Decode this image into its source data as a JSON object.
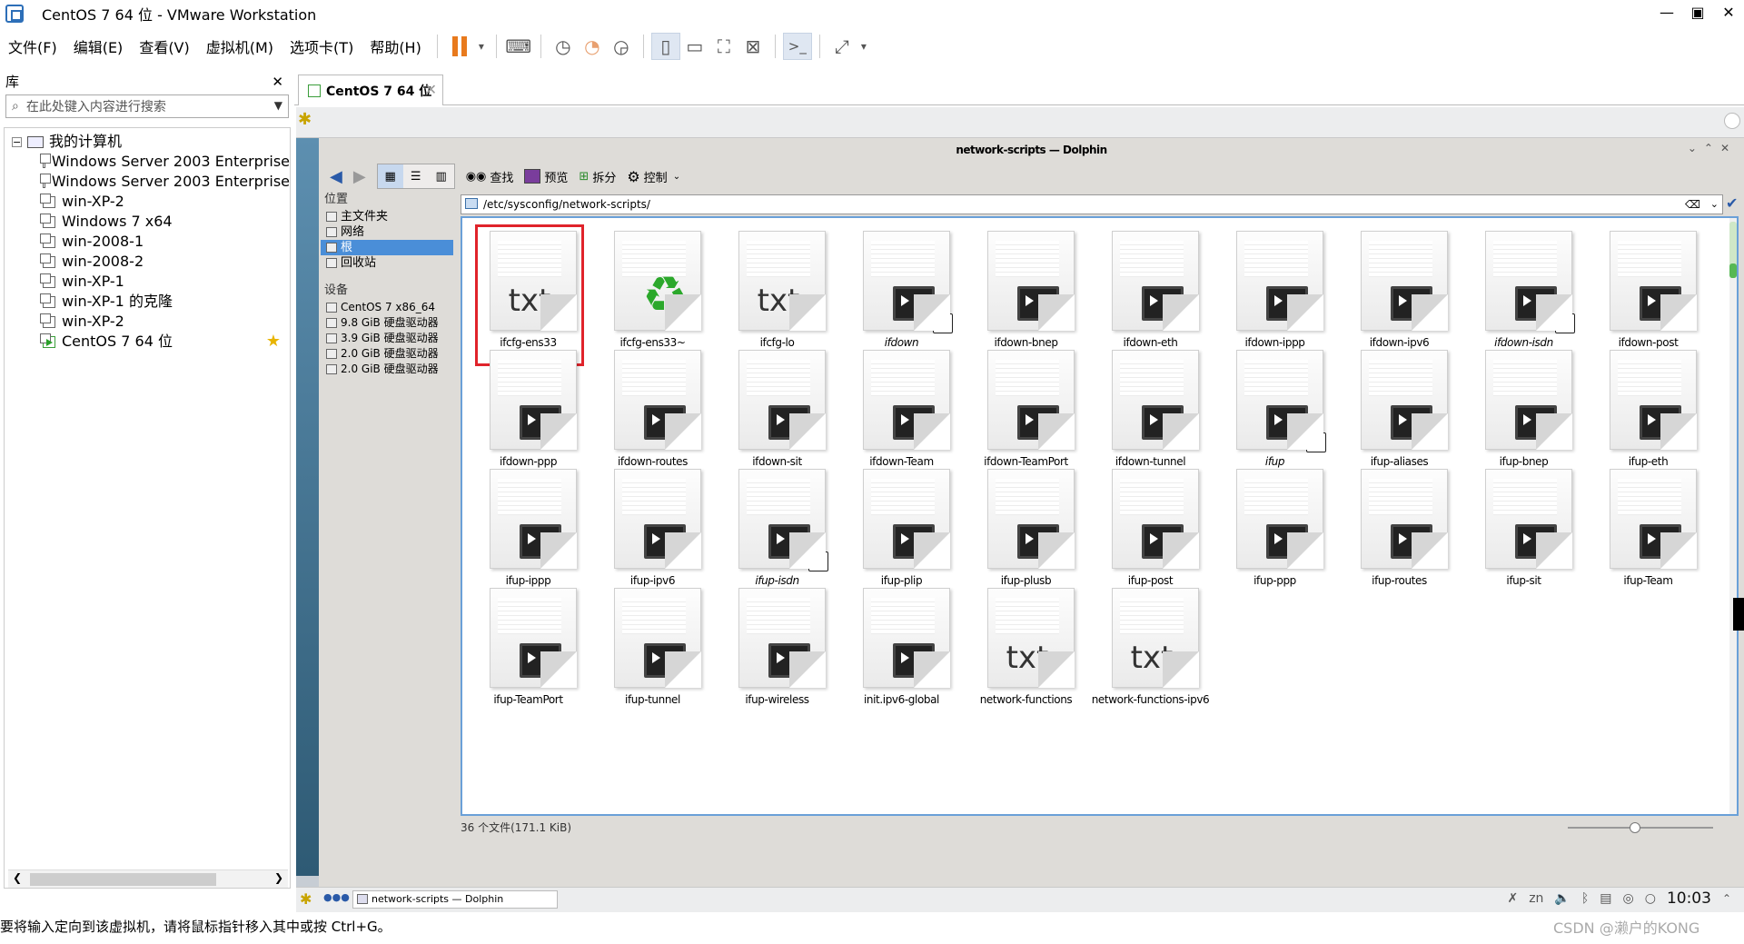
{
  "window": {
    "title": "CentOS 7 64 位 - VMware Workstation",
    "min": "—",
    "restore": "▣",
    "close": "✕"
  },
  "menus": [
    "文件(F)",
    "编辑(E)",
    "查看(V)",
    "虚拟机(M)",
    "选项卡(T)",
    "帮助(H)"
  ],
  "library": {
    "title": "库",
    "close": "✕",
    "search_placeholder": "在此处键入内容进行搜索",
    "root": "我的计算机",
    "vms": [
      "Windows Server 2003 Enterprise",
      "Windows Server 2003 Enterprise",
      "win-XP-2",
      "Windows 7 x64",
      "win-2008-1",
      "win-2008-2",
      "win-XP-1",
      "win-XP-1 的克隆",
      "win-XP-2",
      "CentOS 7 64 位"
    ],
    "active_vm_index": 9
  },
  "vm_tab": {
    "label": "CentOS 7 64 位",
    "close": "✕"
  },
  "dolphin": {
    "title": "network-scripts — Dolphin",
    "toolbar": {
      "find": "查找",
      "preview": "预览",
      "split": "拆分",
      "control": "控制"
    },
    "places_header": "位置",
    "places": [
      "主文件夹",
      "网络",
      "根",
      "回收站"
    ],
    "selected_place_index": 2,
    "devices_header": "设备",
    "devices": [
      "CentOS 7 x86_64",
      "9.8 GiB 硬盘驱动器",
      "3.9 GiB 硬盘驱动器",
      "2.0 GiB 硬盘驱动器",
      "2.0 GiB 硬盘驱动器"
    ],
    "location": "/etc/sysconfig/network-scripts/",
    "files": [
      {
        "name": "ifcfg-ens33",
        "type": "txt",
        "highlight": true
      },
      {
        "name": "ifcfg-ens33~",
        "type": "recycle"
      },
      {
        "name": "ifcfg-lo",
        "type": "txt"
      },
      {
        "name": "ifdown",
        "type": "script",
        "link": true,
        "italic": true
      },
      {
        "name": "ifdown-bnep",
        "type": "script"
      },
      {
        "name": "ifdown-eth",
        "type": "script"
      },
      {
        "name": "ifdown-ippp",
        "type": "script"
      },
      {
        "name": "ifdown-ipv6",
        "type": "script"
      },
      {
        "name": "ifdown-isdn",
        "type": "script",
        "link": true,
        "italic": true
      },
      {
        "name": "ifdown-post",
        "type": "script"
      },
      {
        "name": "ifdown-ppp",
        "type": "script"
      },
      {
        "name": "ifdown-routes",
        "type": "script"
      },
      {
        "name": "ifdown-sit",
        "type": "script"
      },
      {
        "name": "ifdown-Team",
        "type": "script"
      },
      {
        "name": "ifdown-TeamPort",
        "type": "script"
      },
      {
        "name": "ifdown-tunnel",
        "type": "script"
      },
      {
        "name": "ifup",
        "type": "script",
        "link": true,
        "italic": true
      },
      {
        "name": "ifup-aliases",
        "type": "script"
      },
      {
        "name": "ifup-bnep",
        "type": "script"
      },
      {
        "name": "ifup-eth",
        "type": "script"
      },
      {
        "name": "ifup-ippp",
        "type": "script"
      },
      {
        "name": "ifup-ipv6",
        "type": "script"
      },
      {
        "name": "ifup-isdn",
        "type": "script",
        "link": true,
        "italic": true
      },
      {
        "name": "ifup-plip",
        "type": "script"
      },
      {
        "name": "ifup-plusb",
        "type": "script"
      },
      {
        "name": "ifup-post",
        "type": "script"
      },
      {
        "name": "ifup-ppp",
        "type": "script"
      },
      {
        "name": "ifup-routes",
        "type": "script"
      },
      {
        "name": "ifup-sit",
        "type": "script"
      },
      {
        "name": "ifup-Team",
        "type": "script"
      },
      {
        "name": "ifup-TeamPort",
        "type": "script"
      },
      {
        "name": "ifup-tunnel",
        "type": "script"
      },
      {
        "name": "ifup-wireless",
        "type": "script"
      },
      {
        "name": "init.ipv6-global",
        "type": "script"
      },
      {
        "name": "network-functions",
        "type": "txt"
      },
      {
        "name": "network-functions-ipv6",
        "type": "txt"
      }
    ],
    "status": "36 个文件(171.1 KiB)",
    "txt_label": "txt"
  },
  "taskbar": {
    "task": "network-scripts — Dolphin",
    "clock": "10:03",
    "lang": "zn"
  },
  "statusbar": {
    "hint": "要将输入定向到该虚拟机，请将鼠标指针移入其中或按 Ctrl+G。"
  },
  "watermark": "CSDN @濑户的KONG"
}
